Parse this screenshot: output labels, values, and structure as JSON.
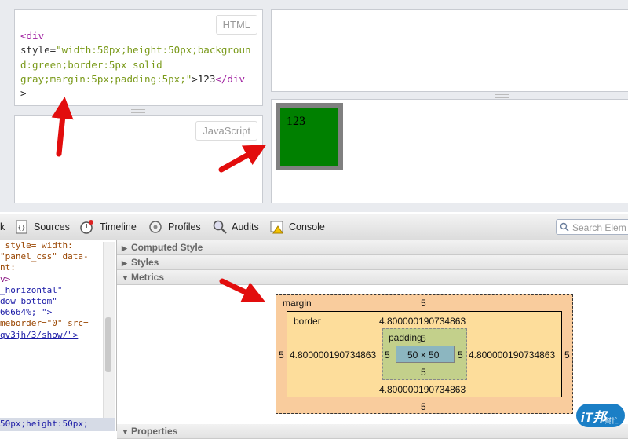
{
  "fiddle": {
    "html_label": "HTML",
    "js_label": "JavaScript",
    "code_lines": [
      {
        "tag": "<div",
        "rest": ""
      },
      {
        "attr": "style=",
        "str": "\"width:50px;height:50px;backgrou"
      },
      {
        "str": "nd:green;border:5px solid"
      },
      {
        "str": "gray;margin:5px;padding:5px;\"",
        "tail": ">123",
        "tag2": "</div"
      },
      {
        "tag": ">"
      }
    ],
    "result_text": "123",
    "box_colors": {
      "border": "#808080",
      "background": "#008000"
    }
  },
  "devtools": {
    "tabs": [
      {
        "label": "k"
      },
      {
        "label": "Sources",
        "icon": "sources-icon"
      },
      {
        "label": "Timeline",
        "icon": "timeline-icon"
      },
      {
        "label": "Profiles",
        "icon": "profiles-icon"
      },
      {
        "label": "Audits",
        "icon": "audits-icon"
      },
      {
        "label": "Console",
        "icon": "console-icon"
      }
    ],
    "search_placeholder": "Search Elem",
    "left_lines": [
      " style= width:",
      "",
      "\"panel_css\" data-",
      "nt:",
      "v>",
      "_horizontal\"",
      "",
      "dow bottom\"",
      "66664%; \">",
      "meborder=\"0\" src=",
      "qv3jh/3/show/\">",
      "",
      "",
      "",
      "",
      "",
      "50px;height:50px;"
    ],
    "sections": {
      "computed": "Computed Style",
      "styles": "Styles",
      "metrics": "Metrics",
      "properties": "Properties"
    },
    "metrics": {
      "margin_label": "margin",
      "border_label": "border",
      "padding_label": "padding",
      "margin_top": "5",
      "margin_bottom": "5",
      "margin_left": "5",
      "margin_right": "5",
      "border_top": "4.800000190734863",
      "border_bottom": "4.800000190734863",
      "border_left": "4.800000190734863",
      "border_right": "4.800000190734863",
      "padding_top": "5",
      "padding_bottom": "5",
      "padding_left": "5",
      "padding_right": "5",
      "content": "50 × 50"
    }
  },
  "watermark": {
    "text": "iT邦",
    "sub": "幫忙"
  },
  "colors": {
    "arrow": "#e20d0d",
    "margin": "#f9cc9d",
    "border": "#fddd9b",
    "padding": "#c3d08b",
    "content": "#8cb6c0"
  }
}
